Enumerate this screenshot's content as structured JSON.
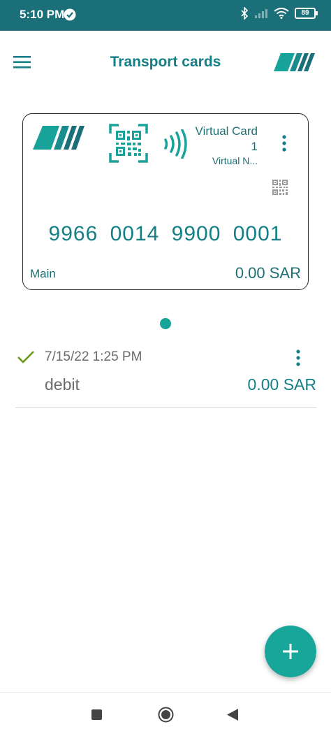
{
  "status_bar": {
    "time": "5:10 PM",
    "battery": "89",
    "icons": [
      "check-circle-icon",
      "bluetooth-icon",
      "signal-icon",
      "wifi-icon",
      "battery-icon"
    ]
  },
  "app_bar": {
    "title": "Transport cards",
    "menu_icon": "hamburger-menu-icon",
    "logo_icon": "transport-logo-icon"
  },
  "card": {
    "name": "Virtual Card 1",
    "subtitle": "Virtual N...",
    "number": "9966 0014 9900 0001",
    "label": "Main",
    "balance": "0.00 SAR",
    "icons": [
      "card-logo-icon",
      "qr-scan-icon",
      "nfc-icon",
      "more-vert-icon",
      "qr-code-icon"
    ]
  },
  "pager": {
    "count": 1,
    "active": 0
  },
  "transactions": [
    {
      "date": "7/15/22 1:25 PM",
      "type": "debit",
      "amount": "0.00 SAR",
      "status_icon": "checkmark-icon"
    }
  ],
  "fab": {
    "icon": "plus-icon"
  },
  "nav_bar": {
    "icons": [
      "recent-apps-icon",
      "home-icon",
      "back-icon"
    ]
  },
  "colors": {
    "primary": "#1b6f78",
    "accent": "#18a69a",
    "text_teal": "#137f86",
    "check_green": "#6a9a1a"
  }
}
